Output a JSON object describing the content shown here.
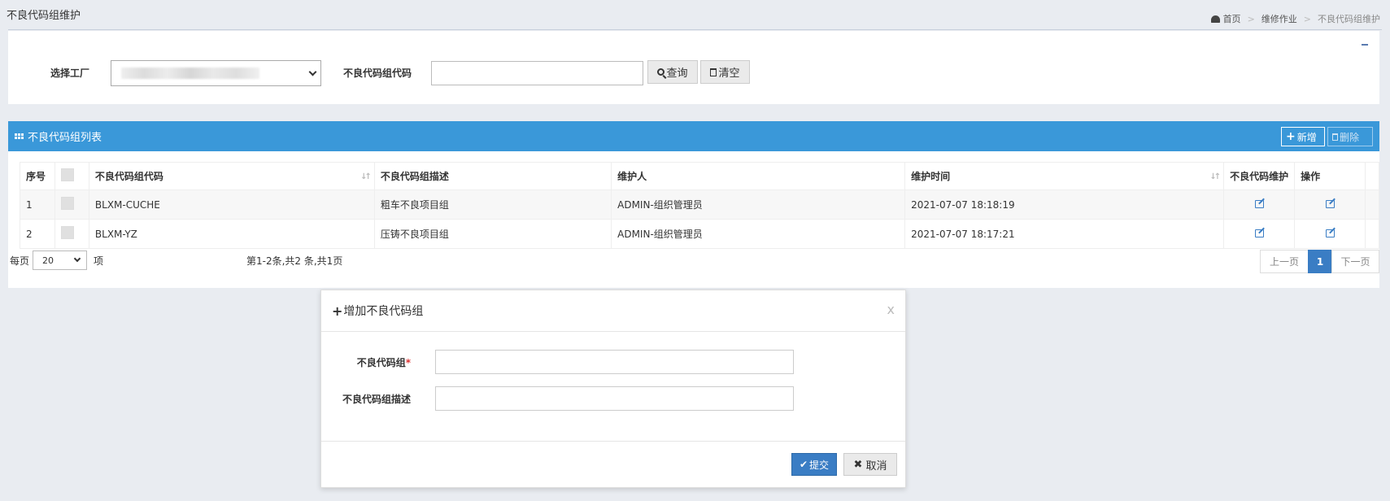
{
  "page": {
    "title": "不良代码组维护"
  },
  "breadcrumb": {
    "home": "首页",
    "sep": ">",
    "section": "维修作业",
    "current": "不良代码组维护"
  },
  "search": {
    "factory_label": "选择工厂",
    "factory_value": "",
    "code_label": "不良代码组代码",
    "code_value": "",
    "query_label": "查询",
    "clear_label": "清空"
  },
  "list": {
    "title": "不良代码组列表",
    "add_label": "新增",
    "delete_label": "删除",
    "columns": [
      "序号",
      "",
      "不良代码组代码",
      "不良代码组描述",
      "维护人",
      "维护时间",
      "不良代码维护",
      "操作"
    ],
    "rows": [
      {
        "index": "1",
        "code": "BLXM-CUCHE",
        "desc": "粗车不良项目组",
        "maintainer": "ADMIN-组织管理员",
        "time": "2021-07-07 18:18:19"
      },
      {
        "index": "2",
        "code": "BLXM-YZ",
        "desc": "压铸不良项目组",
        "maintainer": "ADMIN-组织管理员",
        "time": "2021-07-07 18:17:21"
      }
    ]
  },
  "pager": {
    "per_page_prefix": "每页",
    "per_page_value": "20",
    "per_page_suffix": "项",
    "info": "第1-2条,共2 条,共1页",
    "prev": "上一页",
    "current": "1",
    "next": "下一页"
  },
  "modal": {
    "title": "增加不良代码组",
    "close": "x",
    "group_label": "不良代码组",
    "required_mark": "*",
    "group_value": "",
    "desc_label": "不良代码组描述",
    "desc_value": "",
    "submit_label": "提交",
    "cancel_label": "取消"
  },
  "colors": {
    "header_blue": "#3a98d9",
    "primary": "#3a7dc4",
    "background": "#e9ecf1"
  }
}
